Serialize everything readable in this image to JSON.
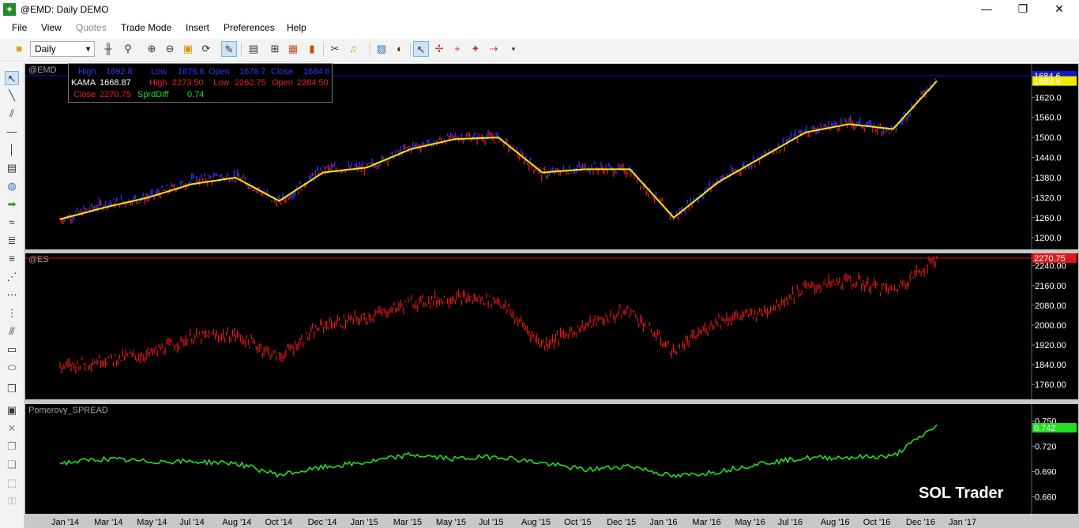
{
  "window": {
    "title": "@EMD: Daily DEMO",
    "controls": {
      "minimize": "—",
      "maximize": "❐",
      "close": "✕"
    }
  },
  "menu": [
    {
      "label": "File",
      "enabled": true
    },
    {
      "label": "View",
      "enabled": true
    },
    {
      "label": "Quotes",
      "enabled": false
    },
    {
      "label": "Trade Mode",
      "enabled": true
    },
    {
      "label": "Insert",
      "enabled": true
    },
    {
      "label": "Preferences",
      "enabled": true
    },
    {
      "label": "Help",
      "enabled": true
    }
  ],
  "toolbar": {
    "interval": "Daily",
    "icons": [
      "instrument-icon",
      "bar-type-icon",
      "zoom-icon",
      "zoom-in-icon",
      "zoom-out-icon",
      "lock-icon",
      "refresh-icon",
      "cursor-mode-icon",
      "template-icon",
      "tree-icon",
      "color-bars-icon",
      "histogram-icon",
      "cut-icon",
      "alert-icon",
      "notebook-icon",
      "mouse-icon",
      "pointer-icon",
      "crosshair-icon",
      "crosshair-red-icon",
      "crosshair-star-icon",
      "crosshair-arrow-icon"
    ]
  },
  "data_window": {
    "row1": {
      "high_label": "High",
      "high": "1692.8",
      "low_label": "Low",
      "low": "1676.6",
      "open_label": "Open",
      "open": "1676.7",
      "close_label": "Close",
      "close": "1684.6"
    },
    "row2": {
      "kama_label": "KAMA",
      "kama": "1668.87",
      "high_label": "High",
      "high": "2273.50",
      "low_label": "Low",
      "low": "2262.75",
      "open_label": "Open",
      "open": "2264.50"
    },
    "row3": {
      "close_label": "Close",
      "close": "2270.75",
      "spread_label": "SprdDiff",
      "spread": "0.74"
    }
  },
  "panes": [
    {
      "label": "@EMD",
      "last_value": "1684.6",
      "kama_value": "1668.9",
      "ticks": [
        "1620.0",
        "1560.0",
        "1500.0",
        "1440.0",
        "1380.0",
        "1320.0",
        "1260.0",
        "1200.0"
      ],
      "colors": {
        "up": "#3030ff",
        "down": "#e01818",
        "kama": "#f5e800",
        "line": "#1515c8"
      }
    },
    {
      "label": "@ES",
      "last_value": "2270.75",
      "ticks": [
        "2240.00",
        "2160.00",
        "2080.00",
        "2000.00",
        "1920.00",
        "1840.00",
        "1760.00"
      ],
      "colors": {
        "bars": "#e01818",
        "line": "#d01010"
      }
    },
    {
      "label": "Pomerovy_SPREAD",
      "last_value": "0.742",
      "ticks": [
        "0.750",
        "0.720",
        "0.690",
        "0.660"
      ],
      "colors": {
        "line": "#22dd22"
      }
    }
  ],
  "x_axis": [
    "Jan '14",
    "Mar '14",
    "May '14",
    "Jul '14",
    "Aug '14",
    "Oct '14",
    "Dec '14",
    "Jan '15",
    "Mar '15",
    "May '15",
    "Jul '15",
    "Aug '15",
    "Oct '15",
    "Dec '15",
    "Jan '16",
    "Mar '16",
    "May '16",
    "Jul '16",
    "Aug '16",
    "Oct '16",
    "Dec '16",
    "Jan '17"
  ],
  "chart_data": {
    "type": "line",
    "x": [
      "Jan '14",
      "Mar '14",
      "May '14",
      "Jul '14",
      "Aug '14",
      "Oct '14",
      "Dec '14",
      "Jan '15",
      "Mar '15",
      "May '15",
      "Jul '15",
      "Aug '15",
      "Oct '15",
      "Dec '15",
      "Jan '16",
      "Mar '16",
      "May '16",
      "Jul '16",
      "Aug '16",
      "Oct '16",
      "Dec '16"
    ],
    "series": [
      {
        "name": "@EMD",
        "values": [
          1255,
          1300,
          1320,
          1370,
          1385,
          1305,
          1405,
          1410,
          1470,
          1500,
          1500,
          1390,
          1410,
          1400,
          1260,
          1370,
          1440,
          1520,
          1545,
          1520,
          1680
        ]
      },
      {
        "name": "KAMA",
        "values": [
          1255,
          1290,
          1320,
          1360,
          1380,
          1310,
          1395,
          1410,
          1465,
          1495,
          1500,
          1395,
          1405,
          1405,
          1260,
          1365,
          1440,
          1515,
          1540,
          1525,
          1669
        ]
      },
      {
        "name": "@ES",
        "values": [
          1830,
          1860,
          1880,
          1950,
          1960,
          1870,
          2000,
          2030,
          2090,
          2110,
          2100,
          1920,
          2000,
          2060,
          1890,
          2020,
          2050,
          2150,
          2180,
          2140,
          2270
        ]
      },
      {
        "name": "Pomerovy_SPREAD",
        "values": [
          0.7,
          0.705,
          0.702,
          0.702,
          0.7,
          0.686,
          0.695,
          0.701,
          0.71,
          0.705,
          0.708,
          0.7,
          0.692,
          0.697,
          0.684,
          0.69,
          0.7,
          0.706,
          0.707,
          0.708,
          0.745
        ]
      }
    ]
  },
  "watermark": "SOL Trader"
}
